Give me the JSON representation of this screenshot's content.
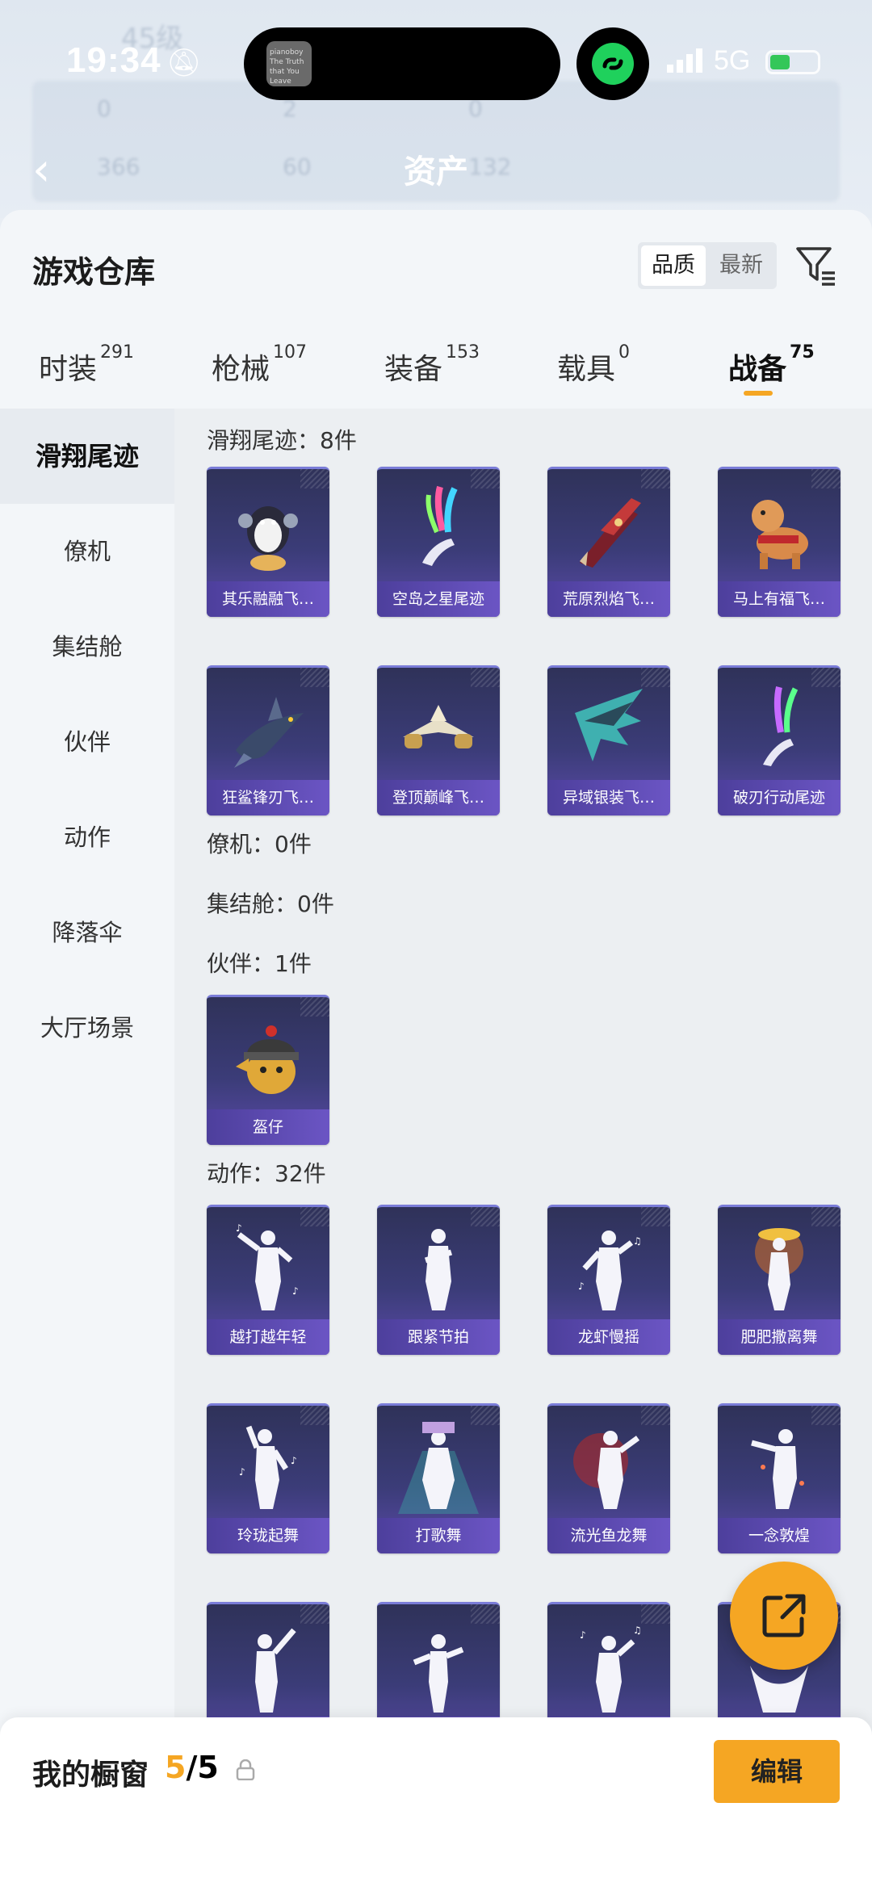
{
  "status_bar": {
    "time": "19:34",
    "network": "5G"
  },
  "background": {
    "title": "资产",
    "level": "45级",
    "stats": [
      "0",
      "2",
      "0",
      "366",
      "60",
      "132"
    ]
  },
  "island": {
    "art_text": "pianoboy The Truth that You Leave"
  },
  "sheet": {
    "title": "游戏仓库",
    "sort": {
      "active": "品质",
      "inactive": "最新"
    }
  },
  "tabs": [
    {
      "label": "时装",
      "count": "291"
    },
    {
      "label": "枪械",
      "count": "107"
    },
    {
      "label": "装备",
      "count": "153"
    },
    {
      "label": "载具",
      "count": "0"
    },
    {
      "label": "战备",
      "count": "75"
    }
  ],
  "sidebar": [
    "滑翔尾迹",
    "僚机",
    "集结舱",
    "伙伴",
    "动作",
    "降落伞",
    "大厅场景"
  ],
  "sections": {
    "trail": {
      "header": "滑翔尾迹：8件",
      "items": [
        "其乐融融飞…",
        "空岛之星尾迹",
        "荒原烈焰飞…",
        "马上有福飞…",
        "狂鲨锋刃飞…",
        "登顶巅峰飞…",
        "异域银装飞…",
        "破刃行动尾迹"
      ]
    },
    "wingman": {
      "header": "僚机：0件"
    },
    "capsule": {
      "header": "集结舱：0件"
    },
    "partner": {
      "header": "伙伴：1件",
      "items": [
        "盔仔"
      ]
    },
    "emote": {
      "header": "动作：32件",
      "items": [
        "越打越年轻",
        "跟紧节拍",
        "龙虾慢摇",
        "肥肥撒离舞",
        "玲珑起舞",
        "打歌舞",
        "流光鱼龙舞",
        "一念敦煌",
        "",
        "",
        "",
        ""
      ]
    }
  },
  "showcase": {
    "title": "我的橱窗",
    "used": "5",
    "total": "/5",
    "edit_label": "编辑"
  },
  "colors": {
    "accent": "#f5a623",
    "card_top": "#2f3259",
    "card_bottom": "#5a4aa8",
    "label_bar": "#6b55c4"
  }
}
